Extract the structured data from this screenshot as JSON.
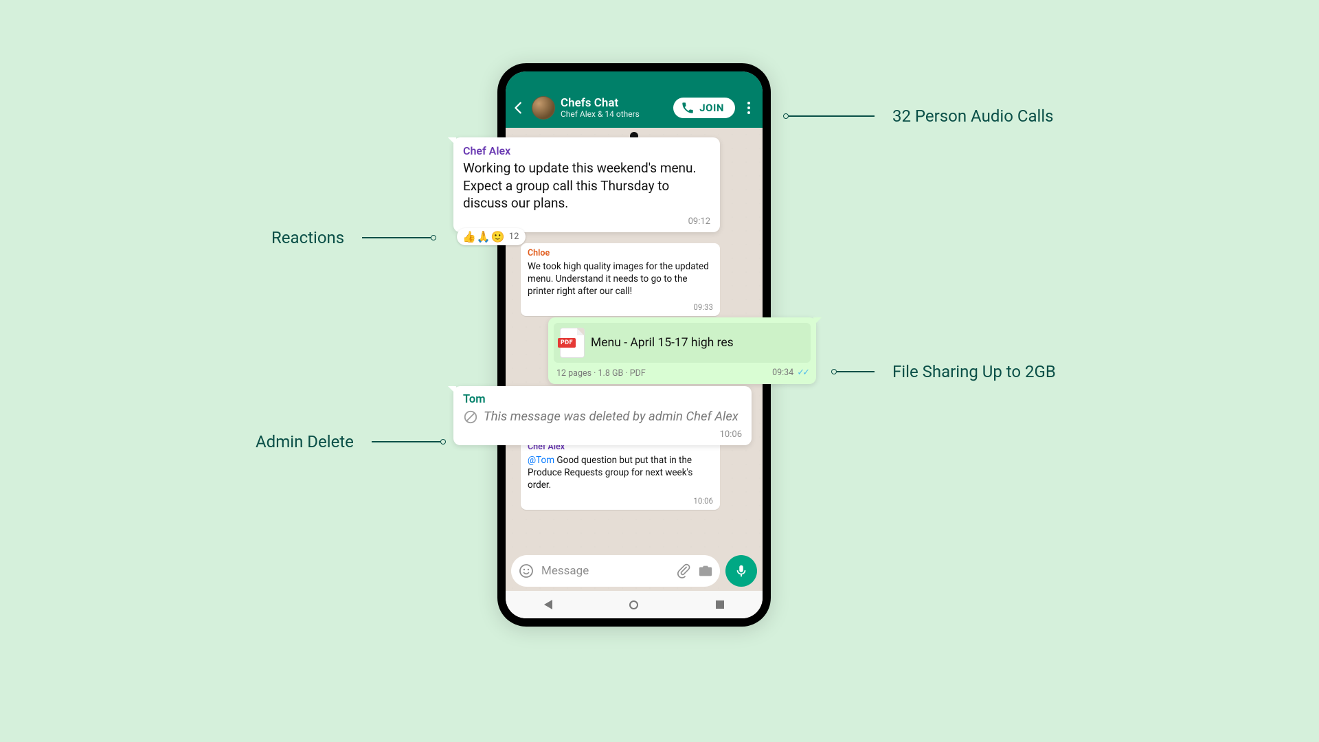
{
  "header": {
    "title": "Chefs Chat",
    "subtitle": "Chef Alex & 14 others",
    "join_label": "JOIN"
  },
  "messages": {
    "m1": {
      "sender": "Chef Alex",
      "sender_color": "#6a3ab2",
      "text": "Working to update this weekend's menu. Expect a group call this Thursday to discuss our plans.",
      "time": "09:12"
    },
    "reactions": {
      "emojis": "👍🙏🙂",
      "count": "12"
    },
    "m2": {
      "sender": "Chloe",
      "sender_color": "#e05a1a",
      "text": "We took high quality images for the updated menu. Understand it needs to go to the printer right after our call!",
      "time": "09:33"
    },
    "file": {
      "name": "Menu - April 15-17 high res",
      "meta": "12 pages  ·  1.8 GB  ·  PDF",
      "time": "09:34",
      "pdf_badge": "PDF"
    },
    "deleted": {
      "sender": "Tom",
      "sender_color": "#008069",
      "text": "This message was deleted by admin Chef Alex",
      "time": "10:06"
    },
    "m3": {
      "sender": "Chef Alex",
      "sender_color": "#6a3ab2",
      "mention": "@Tom",
      "text": " Good question but put that in the Produce Requests group for next week's order.",
      "time": "10:06"
    }
  },
  "composer": {
    "placeholder": "Message"
  },
  "callouts": {
    "audio_calls": "32 Person Audio Calls",
    "reactions": "Reactions",
    "file_sharing": "File Sharing Up to 2GB",
    "admin_delete": "Admin Delete"
  }
}
